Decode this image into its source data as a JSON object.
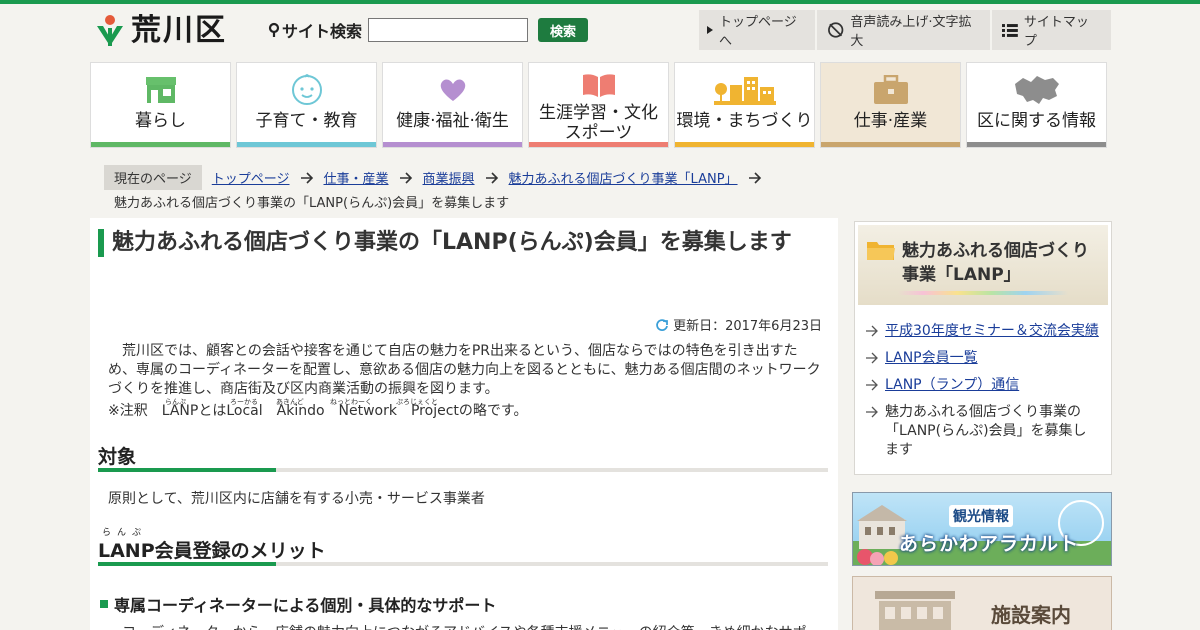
{
  "header": {
    "logo_text": "荒川区",
    "search_label": "サイト検索",
    "search_button": "検索",
    "utility": [
      {
        "label": "トップページへ",
        "icon": "triangle-right-icon"
      },
      {
        "label": "音声読み上げ·文字拡大",
        "icon": "no-speech-icon"
      },
      {
        "label": "サイトマップ",
        "icon": "list-icon"
      }
    ]
  },
  "nav": [
    {
      "label": "暮らし",
      "icon": "house-icon",
      "color": "#5fb865"
    },
    {
      "label": "子育て・教育",
      "icon": "baby-face-icon",
      "color": "#6ec7d6"
    },
    {
      "label": "健康·福祉·衛生",
      "icon": "heart-icon",
      "color": "#b58fd0"
    },
    {
      "label_line1": "生涯学習・文化",
      "label_line2": "スポーツ",
      "icon": "book-icon",
      "color": "#ee7d72"
    },
    {
      "label": "環境・まちづくり",
      "icon": "buildings-icon",
      "color": "#f0b431"
    },
    {
      "label": "仕事·産業",
      "icon": "briefcase-icon",
      "color": "#c9a56d"
    },
    {
      "label": "区に関する情報",
      "icon": "map-icon",
      "color": "#8d8d8d"
    }
  ],
  "breadcrumb": {
    "current_label": "現在のページ",
    "links": [
      "トップページ",
      "仕事・産業",
      "商業振興",
      "魅力あふれる個店づくり事業「LANP」"
    ],
    "page": "魅力あふれる個店づくり事業の「LANP(らんぷ)会員」を募集します"
  },
  "article": {
    "title": "魅力あふれる個店づくり事業の「LANP(らんぷ)会員」を募集します",
    "updated": "更新日：2017年6月23日",
    "intro_1": "荒川区では、顧客との会話や接客を通じて自店の魅力をPR出来るという、個店ならではの特色を引き出すた",
    "intro_2": "め、専属のコーディネーターを配置し、意欲ある個店の魅力向上を図るとともに、魅力ある個店間のネットワーク",
    "intro_3": "づくりを推進し、商店街及び区内商業活動の振興を図ります。",
    "note": "※注釈　LANPとはLocal　Akindo　Network　Projectの略です。",
    "ruby_lanp": "らんぷ",
    "ruby_local": "ろーかる",
    "ruby_akindo": "あきんど",
    "ruby_network": "ねっとわーく",
    "ruby_project": "ぷろじぇくと",
    "h2_target": "対象",
    "target_text": "原則として、荒川区内に店舗を有する小売・サービス事業者",
    "h2_merit_ruby": "らんぷ",
    "h2_merit": "LANP会員登録のメリット",
    "h3_support": "専属コーディネーターによる個別・具体的なサポート",
    "support_text": "コーディネーターから、店舗の魅力向上につながるアドバイスや各種支援メニューの紹介等、きめ細かなサポー"
  },
  "sidebar": {
    "title": "魅力あふれる個店づくり事業「LANP」",
    "items": [
      {
        "label": "平成30年度セミナー＆交流会実績",
        "link": true
      },
      {
        "label": "LANP会員一覧",
        "link": true
      },
      {
        "label": "LANP（ランプ）通信",
        "link": true
      },
      {
        "label": "魅力あふれる個店づくり事業の「LANP(らんぷ)会員」を募集します",
        "link": false
      }
    ],
    "banner_tourism_tag": "観光情報",
    "banner_tourism_title": "あらかわアラカルト",
    "banner_facility": "施設案内"
  },
  "colors": {
    "accent": "#1a9a4f",
    "link": "#1a3d99"
  }
}
